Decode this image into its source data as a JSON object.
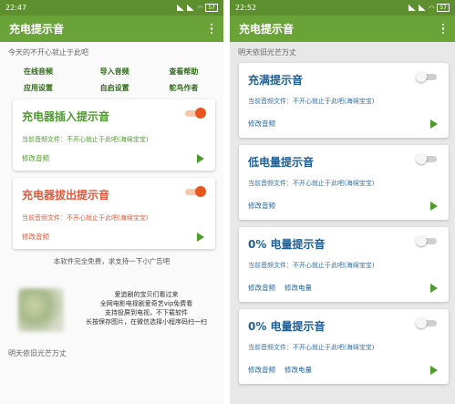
{
  "left": {
    "status": {
      "time": "22:47",
      "battery": "57"
    },
    "app_title": "充电提示音",
    "quote": "今天的不开心就止于此吧",
    "actions": [
      "在线音频",
      "导入音频",
      "查看帮助",
      "应用设置",
      "自启设置",
      "鸵鸟作者"
    ],
    "cards": [
      {
        "title": "充电器插入提示音",
        "file": "当前音频文件：不开心就止于此吧(海绵宝宝)",
        "edit": "修改音频",
        "toggle": "on"
      },
      {
        "title": "充电器拔出提示音",
        "file": "当前音频文件：不开心就止于此吧(海绵宝宝)",
        "edit": "修改音频",
        "toggle": "on"
      }
    ],
    "free_note": "本软件完全免费，求支持一下小广告吧",
    "ad_lines": [
      "爱追剧的宝贝们看过来",
      "全网电影电视剧爱奇艺vip免费看",
      "支持投屏到电视，不下载软件",
      "长按保存图片，在微信选择小程序码扫一扫"
    ],
    "bottom_quote": "明天依旧光芒万丈"
  },
  "right": {
    "status": {
      "time": "22:52",
      "battery": "57"
    },
    "app_title": "充电提示音",
    "quote": "明天依旧光芒万丈",
    "cards": [
      {
        "title": "充满提示音",
        "file": "当前音频文件：不开心就止于此吧(海绵宝宝)",
        "edits": [
          "修改音频"
        ],
        "toggle": "off"
      },
      {
        "title": "低电量提示音",
        "file": "当前音频文件：不开心就止于此吧(海绵宝宝)",
        "edits": [
          "修改音频"
        ],
        "toggle": "off"
      },
      {
        "title": "0% 电量提示音",
        "file": "当前音频文件：不开心就止于此吧(海绵宝宝)",
        "edits": [
          "修改音频",
          "修改电量"
        ],
        "toggle": "off"
      },
      {
        "title": "0% 电量提示音",
        "file": "当前音频文件：不开心就止于此吧(海绵宝宝)",
        "edits": [
          "修改音频",
          "修改电量"
        ],
        "toggle": "off"
      }
    ]
  },
  "colors": {
    "appbar": "#6aa338",
    "statusbar": "#5d8f2f",
    "accent_green": "#4e9a2e",
    "accent_red": "#e05a3c",
    "accent_blue": "#1f5f96",
    "toggle_on": "#e8561f"
  },
  "icons": {
    "overflow_menu": "more-vert-icon",
    "play": "play-icon"
  }
}
